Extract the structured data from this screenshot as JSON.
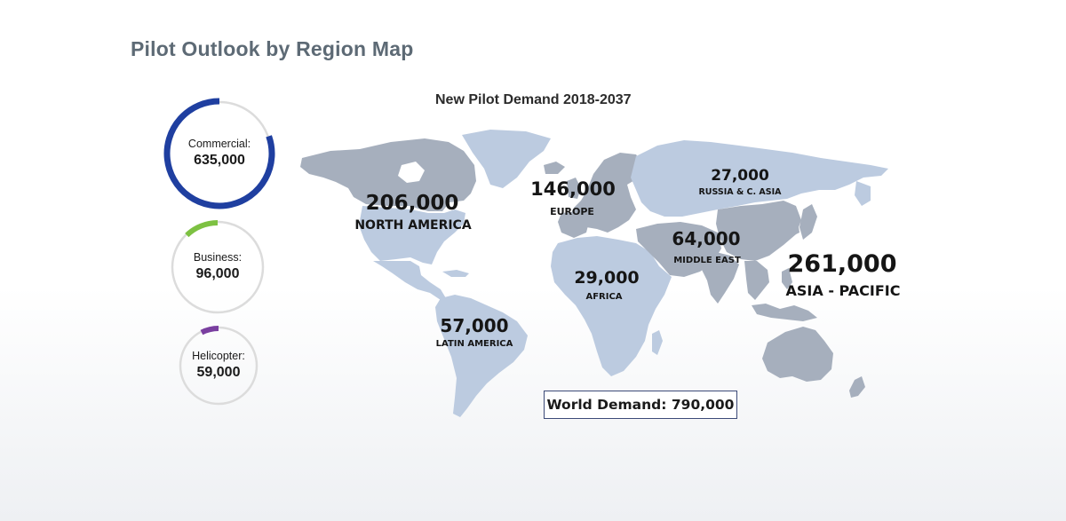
{
  "title": "Pilot Outlook by Region Map",
  "map_title": "New Pilot Demand 2018-2037",
  "segments": [
    {
      "label": "Commercial:",
      "value": "635,000",
      "share": 0.804,
      "color": "#1f3fa0"
    },
    {
      "label": "Business:",
      "value": "96,000",
      "share": 0.122,
      "color": "#7dc142"
    },
    {
      "label": "Helicopter:",
      "value": "59,000",
      "share": 0.075,
      "color": "#7a3fa0"
    }
  ],
  "regions": {
    "north_america": {
      "value": "206,000",
      "name": "NORTH AMERICA"
    },
    "latin_america": {
      "value": "57,000",
      "name": "LATIN AMERICA"
    },
    "europe": {
      "value": "146,000",
      "name": "EUROPE"
    },
    "africa": {
      "value": "29,000",
      "name": "AFRICA"
    },
    "middle_east": {
      "value": "64,000",
      "name": "MIDDLE EAST"
    },
    "russia": {
      "value": "27,000",
      "name": "RUSSIA & C. ASIA"
    },
    "asia_pacific": {
      "value": "261,000",
      "name": "ASIA - PACIFIC"
    }
  },
  "world_demand": "World Demand: 790,000",
  "colors": {
    "map_light": "#bccbe0",
    "map_dark": "#9fa8b6",
    "ring_track": "#dcdcdc"
  }
}
